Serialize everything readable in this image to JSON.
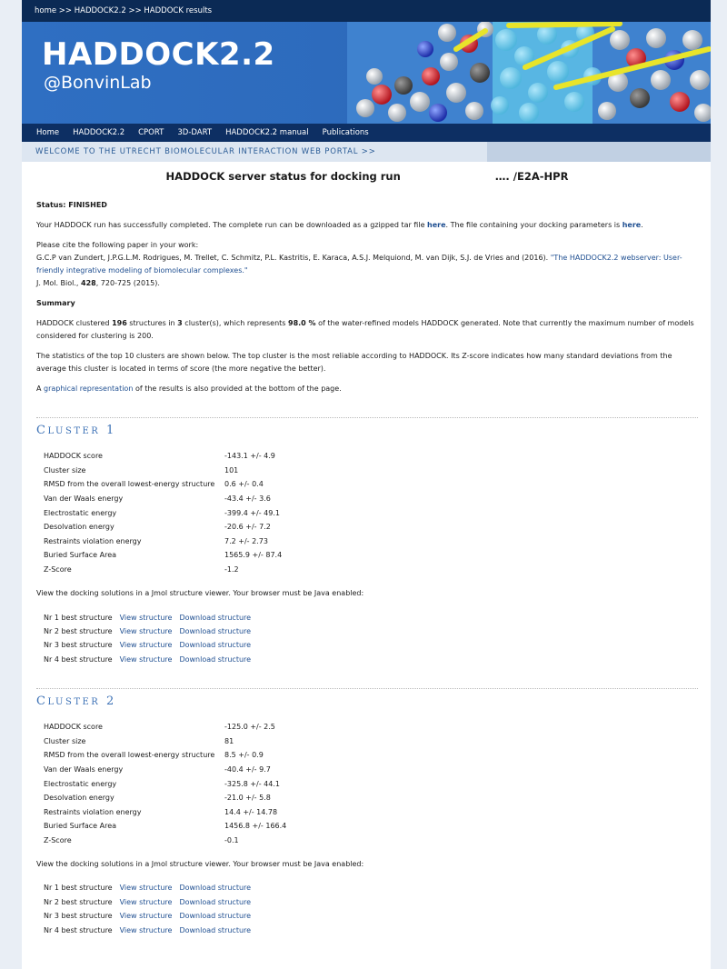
{
  "breadcrumb": "home >> HADDOCK2.2 >> HADDOCK results",
  "banner": {
    "title": "HADDOCK2.2",
    "subtitle": "@BonvinLab"
  },
  "nav": [
    "Home",
    "HADDOCK2.2",
    "CPORT",
    "3D-DART",
    "HADDOCK2.2 manual",
    "Publications"
  ],
  "welcome": "WELCOME TO THE UTRECHT BIOMOLECULAR INTERACTION WEB PORTAL >>",
  "run_title": {
    "prefix": "HADDOCK server status for docking run",
    "suffix": "…. /E2A-HPR"
  },
  "status": "Status: FINISHED",
  "completed": {
    "before": "Your HADDOCK run has successfully completed. The complete run can be downloaded as a gzipped tar file ",
    "link1": "here",
    "middle": ". The file containing your docking parameters is ",
    "link2": "here",
    "after": "."
  },
  "cite": {
    "intro": "Please cite the following paper in your work:",
    "authors": "G.C.P van Zundert, J.P.G.L.M. Rodrigues, M. Trellet, C. Schmitz, P.L. Kastritis, E. Karaca, A.S.J. Melquiond, M. van Dijk, S.J. de Vries and (2016). ",
    "title_link": "\"The HADDOCK2.2 webserver: User-friendly integrative modeling of biomolecular complexes.\"",
    "journal": "J. Mol. Biol., ",
    "volume": "428",
    "pages": ", 720-725 (2015)."
  },
  "summary_heading": "Summary",
  "summary": {
    "t1": "HADDOCK clustered ",
    "n_structures": "196",
    "t2": " structures in ",
    "n_clusters": "3",
    "t3": " cluster(s), which represents ",
    "percent": "98.0 %",
    "t4": " of the water-refined models HADDOCK generated. Note that currently the maximum number of models considered for clustering is 200."
  },
  "stats_text": "The statistics of the top 10 clusters are shown below. The top cluster is the most reliable according to HADDOCK. Its Z-score indicates how many standard deviations from the average this cluster is located in terms of score (the more negative the better).",
  "graphical": {
    "before": "A ",
    "link": "graphical representation",
    "after": " of the results is also provided at the bottom of the page."
  },
  "jmol_note": "View the docking solutions in a Jmol structure viewer. Your browser must be Java enabled:",
  "view_label": "View structure",
  "download_label": "Download structure",
  "clusters": [
    {
      "title_first": "C",
      "title_rest": "LUSTER",
      "number": "1",
      "stats": [
        {
          "label": "HADDOCK score",
          "value": "-143.1 +/- 4.9"
        },
        {
          "label": "Cluster size",
          "value": "101"
        },
        {
          "label": "RMSD from the overall lowest-energy structure",
          "value": "0.6 +/- 0.4"
        },
        {
          "label": "Van der Waals energy",
          "value": "-43.4 +/- 3.6"
        },
        {
          "label": "Electrostatic energy",
          "value": "-399.4 +/- 49.1"
        },
        {
          "label": "Desolvation energy",
          "value": "-20.6 +/- 7.2"
        },
        {
          "label": "Restraints violation energy",
          "value": "7.2 +/- 2.73"
        },
        {
          "label": "Buried Surface Area",
          "value": "1565.9 +/- 87.4"
        },
        {
          "label": "Z-Score",
          "value": "-1.2"
        }
      ],
      "structures": [
        "Nr 1 best structure",
        "Nr 2 best structure",
        "Nr 3 best structure",
        "Nr 4 best structure"
      ]
    },
    {
      "title_first": "C",
      "title_rest": "LUSTER",
      "number": "2",
      "stats": [
        {
          "label": "HADDOCK score",
          "value": "-125.0 +/- 2.5"
        },
        {
          "label": "Cluster size",
          "value": "81"
        },
        {
          "label": "RMSD from the overall lowest-energy structure",
          "value": "8.5 +/- 0.9"
        },
        {
          "label": "Van der Waals energy",
          "value": "-40.4 +/- 9.7"
        },
        {
          "label": "Electrostatic energy",
          "value": "-325.8 +/- 44.1"
        },
        {
          "label": "Desolvation energy",
          "value": "-21.0 +/- 5.8"
        },
        {
          "label": "Restraints violation energy",
          "value": "14.4 +/- 14.78"
        },
        {
          "label": "Buried Surface Area",
          "value": "1456.8 +/- 166.4"
        },
        {
          "label": "Z-Score",
          "value": "-0.1"
        }
      ],
      "structures": [
        "Nr 1 best structure",
        "Nr 2 best structure",
        "Nr 3 best structure",
        "Nr 4 best structure"
      ]
    }
  ],
  "colors": {
    "header_dark": "#0b2a55",
    "banner_blue": "#2f6fc2",
    "link": "#1f4f91",
    "cluster_title": "#3d72b6"
  }
}
